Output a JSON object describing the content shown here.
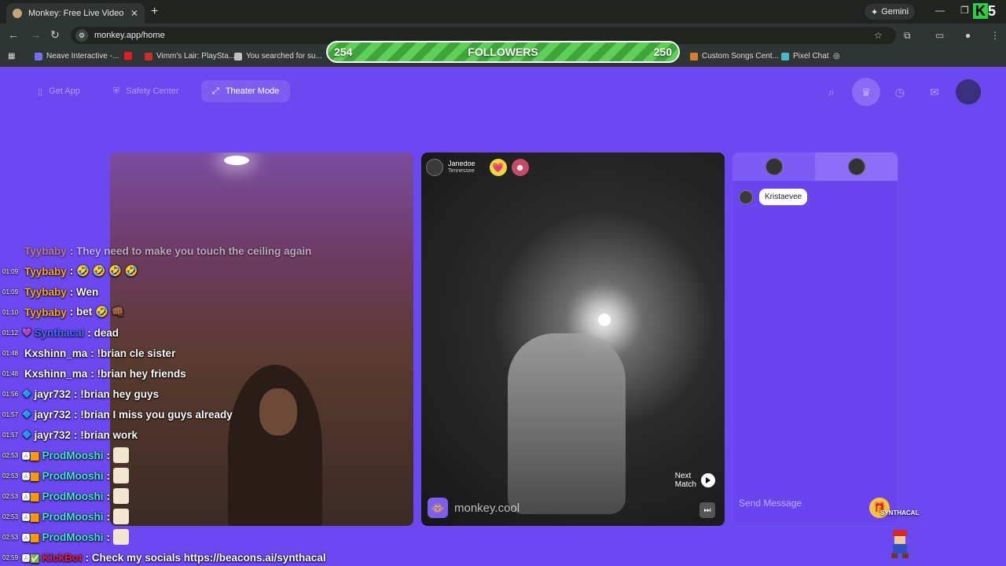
{
  "browser": {
    "tab_title": "Monkey: Free Live Video Ch",
    "url": "monkey.app/home",
    "gemini_label": "Gemini",
    "corner_logo": "5",
    "bookmarks": [
      {
        "label": "Neave Interactive -...",
        "color": "#7a6cf5"
      },
      {
        "label": "",
        "color": "#e02020"
      },
      {
        "label": "Vimm's Lair: PlaySta...",
        "color": "#c43030"
      },
      {
        "label": "You searched for su...",
        "color": "#c0c0c0"
      },
      {
        "label": "Custom Songs Cent...",
        "color": "#d08030"
      },
      {
        "label": "Pixel Chat",
        "color": "#4ab8c8"
      }
    ]
  },
  "followers": {
    "current": "254",
    "label": "FOLLOWERS",
    "goal": "250",
    "fill_fraction": 1.0
  },
  "app": {
    "nav": {
      "get_app": "Get App",
      "safety_center": "Safety Center",
      "theater_mode": "Theater Mode"
    },
    "partner": {
      "name": "Janedoe",
      "location": "Tennessee"
    },
    "next_match": {
      "line1": "Next",
      "line2": "Match"
    },
    "watermark": "monkey.cool",
    "chat": {
      "message_user": "Kristaevee",
      "placeholder": "Send Message"
    }
  },
  "stream_chat": [
    {
      "time": "",
      "icon": "",
      "user": "Tyybaby",
      "user_color": "#f5a623",
      "msg": ": They need to make you touch the ceiling again"
    },
    {
      "time": "01:09",
      "icon": "",
      "user": "Tyybaby",
      "user_color": "#f5a623",
      "msg": ": 🤣 🤣 🤣 🤣"
    },
    {
      "time": "01:09",
      "icon": "",
      "user": "Tyybaby",
      "user_color": "#f5a623",
      "msg": ": Wen"
    },
    {
      "time": "01:10",
      "icon": "",
      "user": "Tyybaby",
      "user_color": "#f5a623",
      "msg": ": bet 🤣 👊🏾"
    },
    {
      "time": "01:12",
      "icon": "💜",
      "user": "Synthacal",
      "user_color": "#4a6cff",
      "msg": ": dead"
    },
    {
      "time": "01:48",
      "icon": "",
      "user": "Kxshinn_ma",
      "user_color": "#ffffff",
      "msg": ": !brian cle sister"
    },
    {
      "time": "01:48",
      "icon": "",
      "user": "Kxshinn_ma",
      "user_color": "#ffffff",
      "msg": ": !brian hey friends"
    },
    {
      "time": "01:56",
      "icon": "🔷",
      "user": "jayr732",
      "user_color": "#ffffff",
      "msg": ": !brian hey guys"
    },
    {
      "time": "01:57",
      "icon": "🔷",
      "user": "jayr732",
      "user_color": "#ffffff",
      "msg": ": !brian I miss you guys already"
    },
    {
      "time": "01:57",
      "icon": "🔷",
      "user": "jayr732",
      "user_color": "#ffffff",
      "msg": ": !brian work"
    },
    {
      "time": "02:53",
      "icon": "🅰🟧",
      "user": "ProdMooshi",
      "user_color": "#3ee8e0",
      "msg": ":"
    },
    {
      "time": "02:53",
      "icon": "🅰🟧",
      "user": "ProdMooshi",
      "user_color": "#3ee8e0",
      "msg": ":"
    },
    {
      "time": "02:53",
      "icon": "🅰🟧",
      "user": "ProdMooshi",
      "user_color": "#3ee8e0",
      "msg": ":"
    },
    {
      "time": "02:53",
      "icon": "🅰🟧",
      "user": "ProdMooshi",
      "user_color": "#3ee8e0",
      "msg": ":"
    },
    {
      "time": "02:53",
      "icon": "🅰🟧",
      "user": "ProdMooshi",
      "user_color": "#3ee8e0",
      "msg": ":"
    },
    {
      "time": "02:59",
      "icon": "🅰✅",
      "user": "KickBot",
      "user_color": "#e0203a",
      "msg": ": Check my socials https://beacons.ai/synthacal"
    }
  ],
  "overlay_label": "SYNTHACAL",
  "colors": {
    "app_bg": "#6c48f0",
    "follower_bar": "#4aa84a"
  }
}
